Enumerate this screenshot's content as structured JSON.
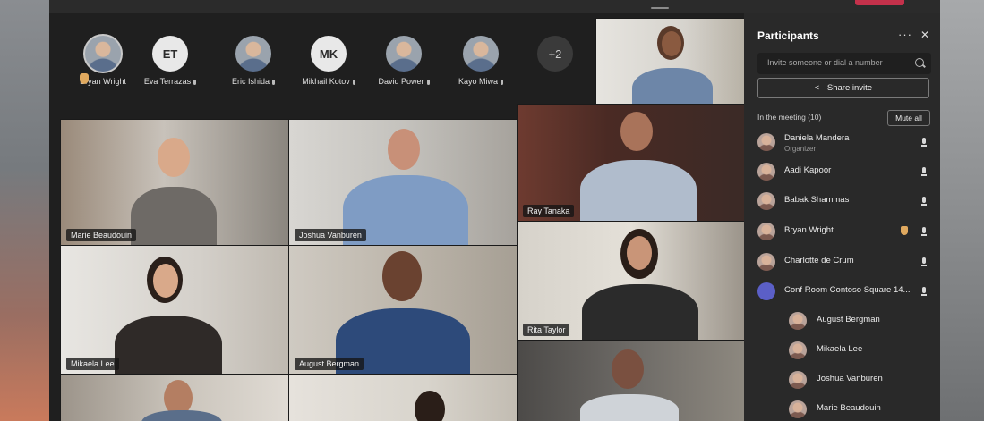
{
  "strip": {
    "participants": [
      {
        "name": "Bryan Wright",
        "initials": "",
        "type": "photo"
      },
      {
        "name": "Eva Terrazas",
        "initials": "ET",
        "type": "initials"
      },
      {
        "name": "Eric Ishida",
        "initials": "",
        "type": "photo"
      },
      {
        "name": "Mikhail Kotov",
        "initials": "MK",
        "type": "initials"
      },
      {
        "name": "David Power",
        "initials": "",
        "type": "photo"
      },
      {
        "name": "Kayo Miwa",
        "initials": "",
        "type": "photo"
      }
    ],
    "overflow_label": "+2"
  },
  "tiles": [
    {
      "name": "Marie Beaudouin"
    },
    {
      "name": "Joshua Vanburen"
    },
    {
      "name": "Ray Tanaka"
    },
    {
      "name": "Mikaela Lee"
    },
    {
      "name": "August Bergman"
    },
    {
      "name": "Rita Taylor"
    }
  ],
  "panel": {
    "title": "Participants",
    "more_label": "···",
    "close_label": "✕",
    "invite_placeholder": "Invite someone or dial a number",
    "share_label": "Share invite",
    "in_meeting_label": "In the meeting (10)",
    "mute_all_label": "Mute all",
    "people": [
      {
        "name": "Daniela Mandera",
        "role": "Organizer"
      },
      {
        "name": "Aadi Kapoor",
        "role": ""
      },
      {
        "name": "Babak Shammas",
        "role": ""
      },
      {
        "name": "Bryan Wright",
        "role": ""
      },
      {
        "name": "Charlotte de Crum",
        "role": ""
      },
      {
        "name": "Conf Room Contoso Square 14...",
        "role": ""
      },
      {
        "name": "August Bergman",
        "role": ""
      },
      {
        "name": "Mikaela Lee",
        "role": ""
      },
      {
        "name": "Joshua Vanburen",
        "role": ""
      },
      {
        "name": "Marie Beaudouin",
        "role": ""
      }
    ]
  },
  "colors": {
    "accent": "#5b5fc7",
    "panel_bg": "#292929",
    "app_bg": "#1f1f1f",
    "alert": "#c4314b",
    "raised_hand": "#e0a95f"
  },
  "icons": [
    "more-icon",
    "close-icon",
    "search-icon",
    "share-icon",
    "mic-icon",
    "raised-hand-icon"
  ]
}
